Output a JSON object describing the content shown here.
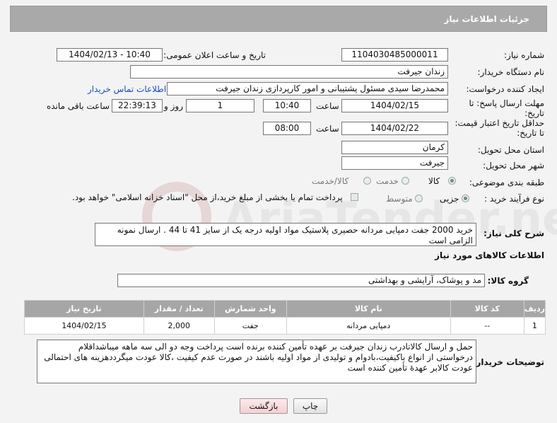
{
  "header": {
    "title": "جزئیات اطلاعات نیاز"
  },
  "fields": {
    "need_number_label": "شماره نیاز:",
    "need_number": "1104030485000011",
    "announce_label": "تاریخ و ساعت اعلان عمومی:",
    "announce_value": "1404/02/13 - 10:40",
    "buyer_org_label": "نام دستگاه خریدار:",
    "buyer_org": "زندان جیرفت",
    "creator_label": "ایجاد کننده درخواست:",
    "creator": "محمدرضا سیدی مسئول پشتیبانی و امور کارپردازی زندان جیرفت",
    "contact_link": "اطلاعات تماس خریدار",
    "deadline_label_1": "مهلت ارسال پاسخ: تا",
    "deadline_label_2": "تاریخ:",
    "deadline_date": "1404/02/15",
    "time_label": "ساعت",
    "deadline_time": "10:40",
    "days_value": "1",
    "days_label": "روز و",
    "remaining_value": "22:39:13",
    "remaining_label": "ساعت باقی مانده",
    "price_label_1": "حداقل تاریخ اعتبار قیمت:",
    "price_label_2": "تا تاریخ:",
    "price_date": "1404/02/22",
    "price_time": "08:00",
    "province_label": "استان محل تحویل:",
    "province": "کرمان",
    "city_label": "شهر محل تحویل:",
    "city": "جیرفت",
    "category_label": "طبقه بندی موضوعی:",
    "category_options": [
      "کالا",
      "خدمت",
      "کالا/خدمت"
    ],
    "process_label": "نوع فرآیند خرید :",
    "process_options": [
      "جزیی",
      "متوسط"
    ],
    "payment_note": "پرداخت تمام یا بخشی از مبلغ خرید،از محل \"اسناد خزانه اسلامی\" خواهد بود."
  },
  "description": {
    "label": "شرح کلی نیاز:",
    "text": "خرید 2000 جفت دمپایی مردانه حصیری پلاستیک مواد اولیه درجه یک از سایز 41 تا 44 . ارسال نمونه الزامی است"
  },
  "goods": {
    "section_title": "اطلاعات کالاهای مورد نیاز",
    "group_label": "گروه کالا:",
    "group_value": "مد و پوشاک، آرایشی و بهداشتی",
    "headers": [
      "ردیف",
      "کد کالا",
      "نام کالا",
      "واحد شمارش",
      "تعداد / مقدار",
      "تاریخ نیاز"
    ],
    "rows": [
      {
        "row": "1",
        "code": "--",
        "name": "دمپایی مردانه",
        "unit": "جفت",
        "qty": "2,000",
        "date": "1404/02/15"
      }
    ]
  },
  "notes": {
    "label": "توضیحات خریدار:",
    "text": "حمل و ارسال کالاتادرب زندان جیرفت بر عهده تأمین کننده برنده است پرداخت وجه دو الی سه ماهه میباشداقلام درخواستی از انواع باکیفیت،بادوام و تولیدی از مواد اولیه باشند در صورت عدم کیفیت ،کالا عودت میگرددهزینه های احتمالی عودت کالابر عهدهٔ تأمین کننده است"
  },
  "buttons": {
    "print": "چاپ",
    "back": "بازگشت"
  },
  "watermark": {
    "text": "AriaTender.neT"
  }
}
